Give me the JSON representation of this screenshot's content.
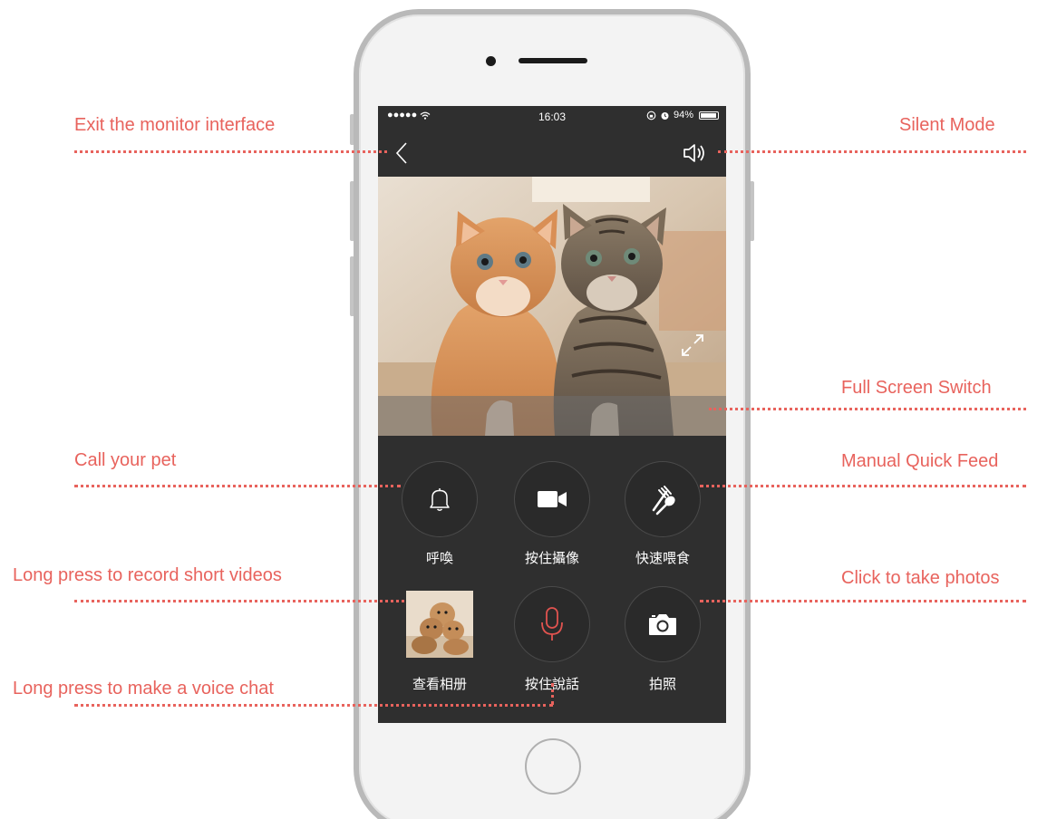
{
  "status_bar": {
    "signal": "●●●●● ",
    "time": "16:03",
    "battery": "94%"
  },
  "controls": {
    "call_label": "呼喚",
    "record_label": "按住攝像",
    "feed_label": "快速喂食",
    "album_label": "查看相册",
    "talk_label": "按住說話",
    "photo_label": "拍照"
  },
  "annotations": {
    "exit": "Exit the monitor interface",
    "silent": "Silent Mode",
    "fullscreen": "Full Screen Switch",
    "call": "Call your pet",
    "feed": "Manual Quick Feed",
    "record": "Long press to record short videos",
    "photo": "Click to take photos",
    "voice": "Long press to make a voice chat"
  },
  "icons": {
    "back": "chevron-left-icon",
    "silent": "speaker-icon",
    "fullscreen": "expand-arrows-icon",
    "call": "bell-icon",
    "record": "video-camera-icon",
    "feed": "fork-spoon-icon",
    "talk": "microphone-icon",
    "photo": "camera-icon"
  },
  "colors": {
    "annotation": "#e8635d",
    "screen_bg": "#2f2f2f",
    "mic_accent": "#e0534f"
  }
}
